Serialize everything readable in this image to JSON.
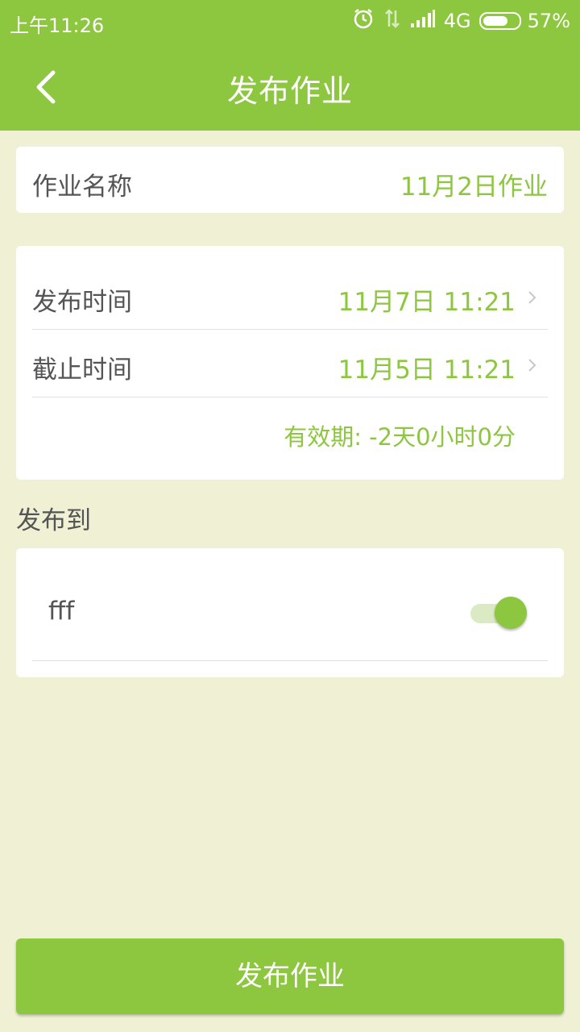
{
  "status_bar": {
    "time": "上午11:26",
    "network": "4G",
    "battery": "57%",
    "icons": [
      "alarm-icon",
      "data-arrows-icon",
      "signal-icon",
      "battery-icon"
    ]
  },
  "header": {
    "title": "发布作业",
    "back_icon": "chevron-left-icon"
  },
  "homework_name": {
    "label": "作业名称",
    "value": "11月2日作业"
  },
  "times": {
    "publish": {
      "label": "发布时间",
      "value": "11月7日 11:21"
    },
    "deadline": {
      "label": "截止时间",
      "value": "11月5日 11:21"
    },
    "validity": "有效期: -2天0小时0分"
  },
  "publish_to": {
    "label": "发布到",
    "items": [
      {
        "name": "fff",
        "enabled": true
      }
    ]
  },
  "publish_button": {
    "label": "发布作业"
  },
  "colors": {
    "primary": "#8dc63f",
    "background": "#f0f1d4",
    "text": "#555555"
  }
}
